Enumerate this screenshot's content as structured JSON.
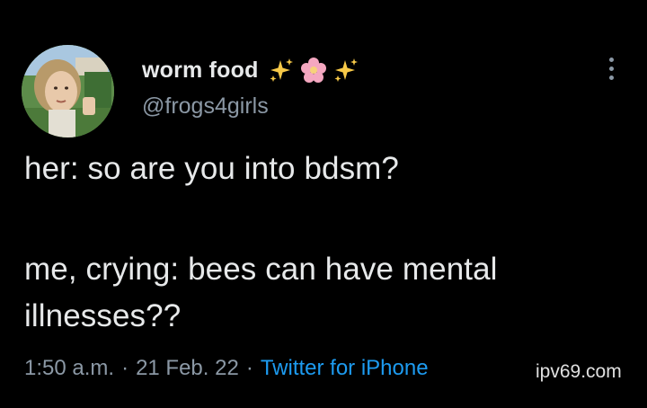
{
  "tweet": {
    "author": {
      "display_name": "worm food",
      "name_emoji": [
        "sparkles-icon",
        "cherry-blossom-icon",
        "sparkles-icon"
      ],
      "handle": "@frogs4girls"
    },
    "body_lines": [
      "her: so are you into bdsm?",
      "me, crying: bees can have mental",
      "illnesses??"
    ],
    "meta": {
      "time": "1:50 a.m.",
      "separator": "·",
      "date": "21 Feb. 22",
      "source": "Twitter for iPhone"
    },
    "more_icon": "more-vertical-icon"
  },
  "watermark": "ipv69.com",
  "colors": {
    "background": "#000000",
    "primary_text": "#e7e9ea",
    "secondary_text": "#8b98a5",
    "link": "#1d9bf0",
    "sparkle": "#f7c948",
    "blossom": "#f4a7c0"
  }
}
